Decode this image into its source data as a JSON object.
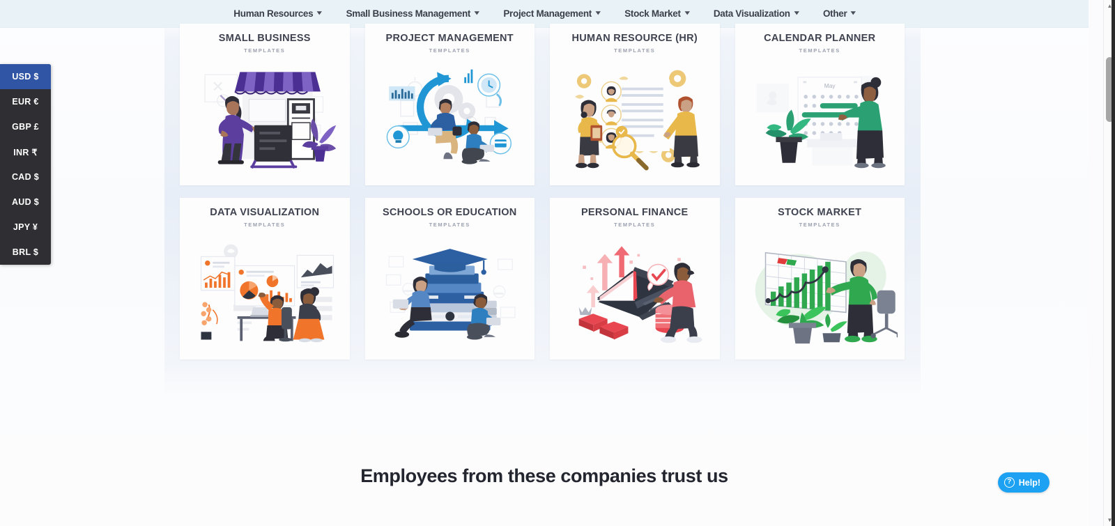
{
  "nav": {
    "items": [
      {
        "label": "Human Resources",
        "icon": "chevron-down-icon"
      },
      {
        "label": "Small Business Management",
        "icon": "chevron-down-icon"
      },
      {
        "label": "Project Management",
        "icon": "chevron-down-icon"
      },
      {
        "label": "Stock Market",
        "icon": "chevron-down-icon"
      },
      {
        "label": "Data Visualization",
        "icon": "chevron-down-icon"
      },
      {
        "label": "Other",
        "icon": "chevron-down-icon"
      }
    ],
    "background_color": "#e9f3f7"
  },
  "currency_rail": {
    "selected": "USD $",
    "active_color": "#2f55a4",
    "background_color": "#2e2e33",
    "items": [
      {
        "label": "USD $",
        "active": true
      },
      {
        "label": "EUR €",
        "active": false
      },
      {
        "label": "GBP £",
        "active": false
      },
      {
        "label": "INR ₹",
        "active": false
      },
      {
        "label": "CAD $",
        "active": false
      },
      {
        "label": "AUD $",
        "active": false
      },
      {
        "label": "JPY ¥",
        "active": false
      },
      {
        "label": "BRL $",
        "active": false
      }
    ]
  },
  "grid": {
    "subtitle": "TEMPLATES",
    "cards": [
      {
        "title": "SMALL BUSINESS",
        "subtitle": "TEMPLATES",
        "accent": "#5b3e9e",
        "art": "small-business-illustration"
      },
      {
        "title": "PROJECT MANAGEMENT",
        "subtitle": "TEMPLATES",
        "accent": "#2196d4",
        "art": "project-management-illustration"
      },
      {
        "title": "HUMAN RESOURCE (HR)",
        "subtitle": "TEMPLATES",
        "accent": "#e8b84b",
        "art": "human-resource-illustration"
      },
      {
        "title": "CALENDAR PLANNER",
        "subtitle": "TEMPLATES",
        "accent": "#2ba173",
        "art": "calendar-planner-illustration"
      },
      {
        "title": "DATA VISUALIZATION",
        "subtitle": "TEMPLATES",
        "accent": "#f0742a",
        "art": "data-visualization-illustration"
      },
      {
        "title": "SCHOOLS OR EDUCATION",
        "subtitle": "TEMPLATES",
        "accent": "#2b5f9e",
        "art": "schools-education-illustration"
      },
      {
        "title": "PERSONAL FINANCE",
        "subtitle": "TEMPLATES",
        "accent": "#e8414c",
        "art": "personal-finance-illustration"
      },
      {
        "title": "STOCK MARKET",
        "subtitle": "TEMPLATES",
        "accent": "#2fa84f",
        "art": "stock-market-illustration"
      }
    ]
  },
  "trust": {
    "heading": "Employees from these companies trust us"
  },
  "help": {
    "label": "Help!",
    "icon": "question-circle-icon",
    "color": "#1da1f2"
  },
  "scrollbar": {
    "up_glyph": "▲",
    "down_glyph": "▼"
  }
}
